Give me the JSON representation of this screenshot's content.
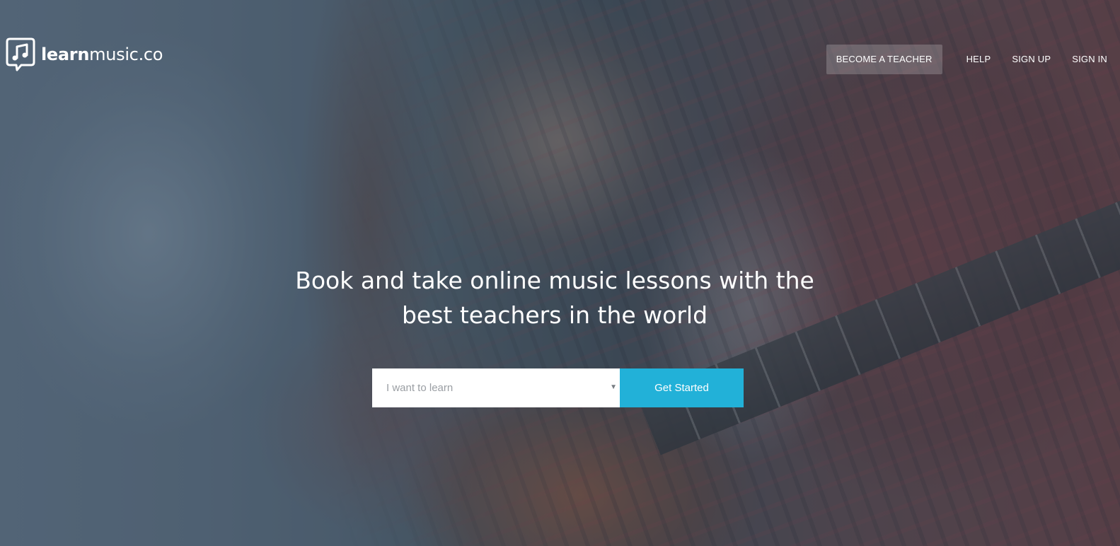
{
  "brand": {
    "name_bold": "learn",
    "name_light": "music.co",
    "logo_icon": "music-note-speech-bubble-icon"
  },
  "nav": {
    "become_teacher": "BECOME A TEACHER",
    "help": "HELP",
    "sign_up": "SIGN UP",
    "sign_in": "SIGN IN"
  },
  "hero": {
    "headline_line1": "Book and take online music lessons with the",
    "headline_line2": "best teachers in the world",
    "select_placeholder": "I want to learn",
    "cta_label": "Get Started"
  },
  "colors": {
    "accent": "#22b1d8",
    "text": "#ffffff",
    "select_bg": "#ffffff",
    "placeholder": "#9a9ea3"
  }
}
